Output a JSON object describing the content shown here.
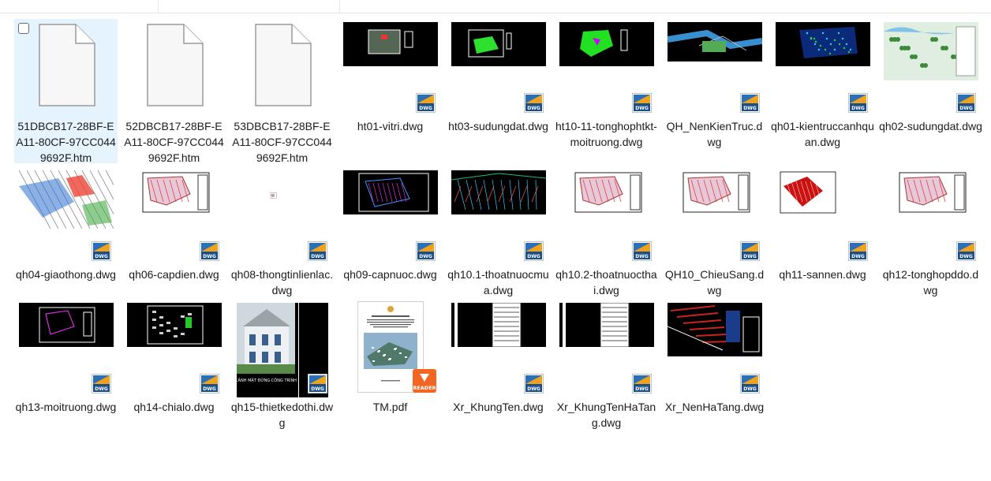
{
  "accent": "#e5f3ff",
  "icons": {
    "dwg_badge": "dwg-file-icon",
    "pdf_badge": "pdf-reader-icon",
    "blank": "blank-document-icon"
  },
  "files": [
    {
      "name": "51DBCB17-28BF-EA11-80CF-97CC0449692F.htm",
      "type": "htm"
    },
    {
      "name": "52DBCB17-28BF-EA11-80CF-97CC0449692F.htm",
      "type": "htm"
    },
    {
      "name": "53DBCB17-28BF-EA11-80CF-97CC0449692F.htm",
      "type": "htm"
    },
    {
      "name": "ht01-vitri.dwg",
      "type": "dwg"
    },
    {
      "name": "ht03-sudungdat.dwg",
      "type": "dwg"
    },
    {
      "name": "ht10-11-tonghophtkt-moitruong.dwg",
      "type": "dwg"
    },
    {
      "name": "QH_NenKienTruc.dwg",
      "type": "dwg"
    },
    {
      "name": "qh01-kientruccanhquan.dwg",
      "type": "dwg"
    },
    {
      "name": "qh02-sudungdat.dwg",
      "type": "dwg"
    },
    {
      "name": "qh04-giaothong.dwg",
      "type": "dwg"
    },
    {
      "name": "qh06-capdien.dwg",
      "type": "dwg"
    },
    {
      "name": "qh08-thongtinlienlac.dwg",
      "type": "dwg"
    },
    {
      "name": "qh09-capnuoc.dwg",
      "type": "dwg"
    },
    {
      "name": "qh10.1-thoatnuocmua.dwg",
      "type": "dwg"
    },
    {
      "name": "qh10.2-thoatnuocthai.dwg",
      "type": "dwg"
    },
    {
      "name": "QH10_ChieuSang.dwg",
      "type": "dwg"
    },
    {
      "name": "qh11-sannen.dwg",
      "type": "dwg"
    },
    {
      "name": "qh12-tonghopddo.dwg",
      "type": "dwg"
    },
    {
      "name": "qh13-moitruong.dwg",
      "type": "dwg"
    },
    {
      "name": "qh14-chialo.dwg",
      "type": "dwg"
    },
    {
      "name": "qh15-thietkedothi.dwg",
      "type": "dwg"
    },
    {
      "name": "TM.pdf",
      "type": "pdf"
    },
    {
      "name": "Xr_KhungTen.dwg",
      "type": "dwg"
    },
    {
      "name": "Xr_KhungTenHaTang.dwg",
      "type": "dwg"
    },
    {
      "name": "Xr_NenHaTang.dwg",
      "type": "dwg"
    }
  ],
  "badges": {
    "dwg": "DWG",
    "pdf": "READER"
  }
}
